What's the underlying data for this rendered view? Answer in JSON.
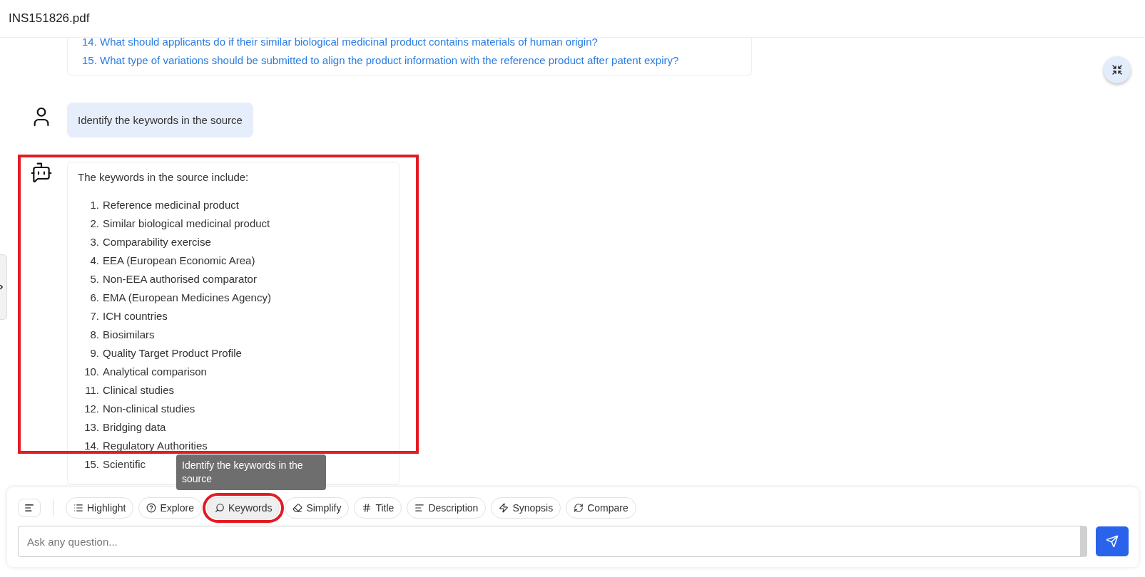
{
  "header": {
    "title": "INS151826.pdf"
  },
  "previous_answer": {
    "questions": [
      {
        "number": "14.",
        "text": "What should applicants do if their similar biological medicinal product contains materials of human origin?"
      },
      {
        "number": "15.",
        "text": "What type of variations should be submitted to align the product information with the reference product after patent expiry?"
      }
    ]
  },
  "user_message": {
    "text": "Identify the keywords in the source"
  },
  "bot_message": {
    "highlighted": true,
    "intro": "The keywords in the source include:",
    "items": [
      {
        "number": "1.",
        "text": "Reference medicinal product"
      },
      {
        "number": "2.",
        "text": "Similar biological medicinal product"
      },
      {
        "number": "3.",
        "text": "Comparability exercise"
      },
      {
        "number": "4.",
        "text": "EEA (European Economic Area)"
      },
      {
        "number": "5.",
        "text": "Non-EEA authorised comparator"
      },
      {
        "number": "6.",
        "text": "EMA (European Medicines Agency)"
      },
      {
        "number": "7.",
        "text": "ICH countries"
      },
      {
        "number": "8.",
        "text": "Biosimilars"
      },
      {
        "number": "9.",
        "text": "Quality Target Product Profile"
      },
      {
        "number": "10.",
        "text": "Analytical comparison"
      },
      {
        "number": "11.",
        "text": "Clinical studies"
      },
      {
        "number": "12.",
        "text": "Non-clinical studies"
      },
      {
        "number": "13.",
        "text": "Bridging data"
      },
      {
        "number": "14.",
        "text": "Regulatory Authorities"
      },
      {
        "number": "15.",
        "text": "Scientific"
      }
    ]
  },
  "tooltip": {
    "text": "Identify the keywords in the source"
  },
  "tools": [
    {
      "kind": "list",
      "label": "Highlight",
      "selected": false,
      "highlighted": false
    },
    {
      "kind": "help",
      "label": "Explore",
      "selected": false,
      "highlighted": false
    },
    {
      "kind": "key",
      "label": "Keywords",
      "selected": true,
      "highlighted": true
    },
    {
      "kind": "eraser",
      "label": "Simplify",
      "selected": false,
      "highlighted": false
    },
    {
      "kind": "hash",
      "label": "Title",
      "selected": false,
      "highlighted": false
    },
    {
      "kind": "lines",
      "label": "Description",
      "selected": false,
      "highlighted": false
    },
    {
      "kind": "bolt",
      "label": "Synopsis",
      "selected": false,
      "highlighted": false
    },
    {
      "kind": "refresh",
      "label": "Compare",
      "selected": false,
      "highlighted": false
    }
  ],
  "input": {
    "placeholder": "Ask any question..."
  }
}
